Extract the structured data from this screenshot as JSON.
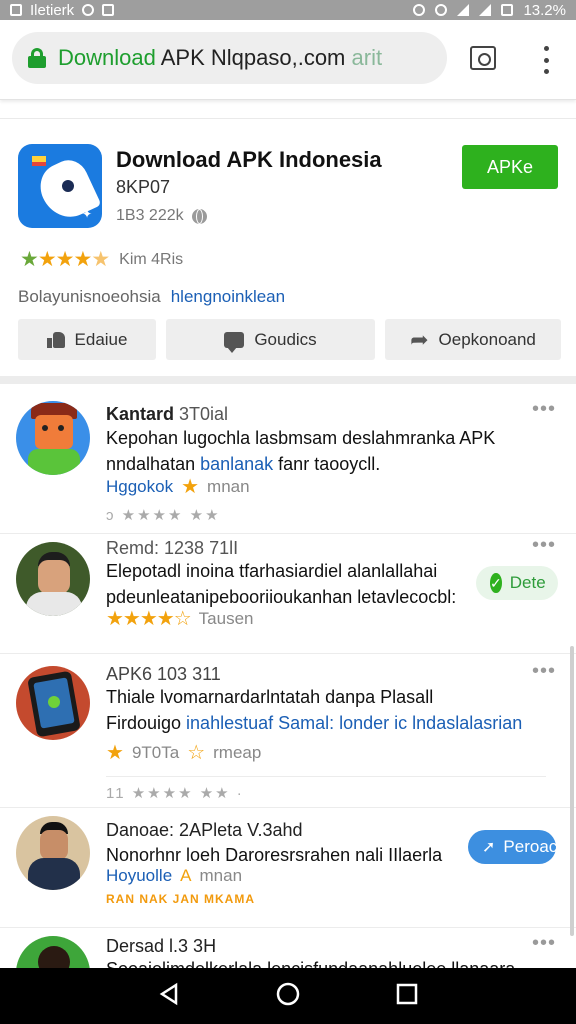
{
  "status_bar": {
    "left_text": "Iletierk",
    "battery_text": "13.2%"
  },
  "browser": {
    "url_scheme": "Download",
    "url_host": " APK Nlqpaso,.com",
    "url_rest": " arit"
  },
  "app": {
    "title": "Download APK Indonesia",
    "subtitle": "8KP07",
    "meta": "1B3 222k",
    "install_label": "APKe",
    "rating_text": "Kim 4Ris",
    "tagline_muted": "Bolayunisnoeohsia",
    "tagline_link": "hlengnoinklean",
    "actions": [
      {
        "label": "Edaiue",
        "icon": "thumbs-up-icon"
      },
      {
        "label": "Goudics",
        "icon": "chat-bubble-icon"
      },
      {
        "label": "Oepkonoand",
        "icon": "share-arrow-icon"
      }
    ]
  },
  "reviews": [
    {
      "name": "Kantard",
      "meta": "3T0ial",
      "text_line1": "Kepohan lugochla lasbmsam deslahmranka APK",
      "text_line2_plain": "nndalhatan ",
      "text_line2_blue": "banlanak",
      "text_line2_rest": " fanr taooycll.",
      "footer_link": "Hggokok",
      "footer_gray": "mnan",
      "stars_text": "ↄ ★★★★  ★★"
    },
    {
      "name": "Remd: 1238",
      "meta": "71lI",
      "text_line1": "Elepotadl inoina tfarhasiardiel alanlallahai",
      "text_line2": "pdeunleatanipebooriioukanhan letavlecocbl:",
      "rating_tail": "Tausen",
      "chip_label": "Dete"
    },
    {
      "name": "APK6 103",
      "meta": "311",
      "text_line1": "Thiale lvomarnardarlntatah danpa Plasall",
      "text_line2_plain": "Firdouigo ",
      "text_line2_blue": "inahlestuaf Samal: londer ic lndaslalasrian",
      "rating_num": "9T0Ta",
      "rating_tail": "rmeap",
      "stars_text": "11 ★★★★  ★★  ·"
    },
    {
      "name": "Danoae: 2APleta",
      "meta": "V.3ahd",
      "text_line1": "Nonorhnr loeh Daroresrsrahen nali IIlaerla",
      "footer_link": "Hoyuolle",
      "footer_letter": "A",
      "footer_gray": "mnan",
      "orange_text": "RAN NAK JAN MKAMA",
      "chip_label": "Peroac"
    },
    {
      "name": "Dersad",
      "meta": "l.3 3H",
      "text_line1": "Sooaielimdelkerlala lencisfundaanahluelee llanaara"
    }
  ],
  "colors": {
    "accent_green": "#2eb11e",
    "link_blue": "#1b5fb5",
    "star_orange": "#f2a20d"
  }
}
